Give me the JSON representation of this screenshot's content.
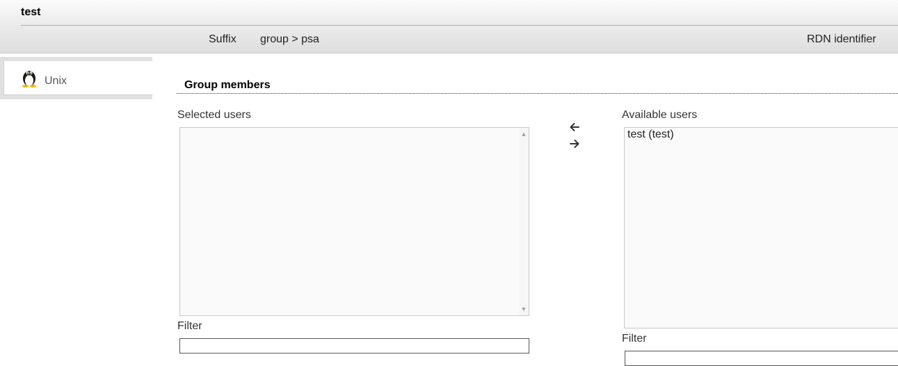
{
  "header": {
    "entry_title": "test",
    "suffix_label": "Suffix",
    "suffix_value": "group > psa",
    "rdn_label": "RDN identifier"
  },
  "tabs": [
    {
      "label": "Unix",
      "icon": "penguin-icon",
      "active": true
    }
  ],
  "section": {
    "title": "Group members"
  },
  "selected_users": {
    "label": "Selected users",
    "options": [],
    "filter_label": "Filter",
    "filter_value": ""
  },
  "available_users": {
    "label": "Available users",
    "options": [
      "test (test)"
    ],
    "filter_label": "Filter",
    "filter_value": ""
  },
  "actions": {
    "add_icon": "arrow-left-icon",
    "remove_icon": "arrow-right-icon"
  },
  "colors": {
    "header_top": "#fbfbfb",
    "header_bottom": "#dedede",
    "tab_panel_bg": "#e0e0e0",
    "list_bg": "#fafafa"
  }
}
